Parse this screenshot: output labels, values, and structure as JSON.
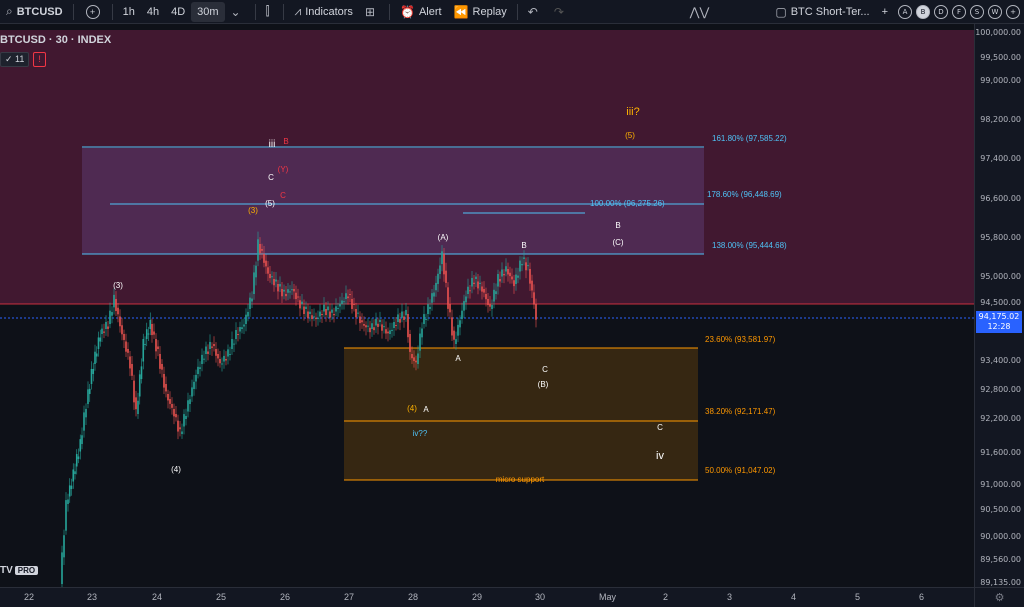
{
  "toolbar": {
    "symbol": "BTCUSD",
    "intervals": [
      "1h",
      "4h",
      "4D",
      "30m"
    ],
    "selected_interval": "30m",
    "indicators": "Indicators",
    "alert": "Alert",
    "replay": "Replay",
    "layout_name": "BTC Short-Ter...",
    "layout_buttons": [
      "A",
      "B",
      "D",
      "F",
      "S",
      "W"
    ],
    "selected_layout_button": "B",
    "more": "+"
  },
  "chart": {
    "title": "BTCUSD · 30 · INDEX",
    "badge_count": "✓ 11",
    "badge_alert": "!",
    "logo": "TV",
    "logo_pro": "PRO",
    "current_price": "94,175.02",
    "countdown": "12:28"
  },
  "price_axis": [
    "100,000.00",
    "99,500.00",
    "99,000.00",
    "98,200.00",
    "97,400.00",
    "96,600.00",
    "95,800.00",
    "95,000.00",
    "94,500.00",
    "93,400.00",
    "92,800.00",
    "92,200.00",
    "91,600.00",
    "91,000.00",
    "90,500.00",
    "90,000.00",
    "89,560.00",
    "89,135.00"
  ],
  "time_axis": [
    "22",
    "23",
    "24",
    "25",
    "26",
    "27",
    "28",
    "29",
    "30",
    "May",
    "2",
    "3",
    "4",
    "5",
    "6"
  ],
  "fib_levels": [
    {
      "label": "161.80% (97,585.22)",
      "color": "#4fc3f7"
    },
    {
      "label": "178.60% (96,448.69)",
      "color": "#4fc3f7"
    },
    {
      "label": "100.00% (96,275.26)",
      "color": "#4fc3f7"
    },
    {
      "label": "138.00% (95,444.68)",
      "color": "#4fc3f7"
    },
    {
      "label": "23.60% (93,581.97)",
      "color": "#ff9800"
    },
    {
      "label": "38.20% (92,171.47)",
      "color": "#ff9800"
    },
    {
      "label": "50.00% (91,047.02)",
      "color": "#ff9800"
    },
    {
      "label": "micro support",
      "color": "#ff9800"
    }
  ],
  "wave_labels": [
    "(3)",
    "(4)",
    "(5)",
    "(3)",
    "iii",
    "B",
    "C",
    "(Y)",
    "C",
    "(A)",
    "A",
    "B",
    "C",
    "(B)",
    "(4)",
    "A",
    "iv??",
    "iii?",
    "(5)",
    "B",
    "(C)",
    "C",
    "iv"
  ],
  "colors": {
    "bull": "#26a69a",
    "bear": "#ef5350",
    "zone_top": "#5a1f3c",
    "zone_bottom": "#3a2a14",
    "accent": "#2962ff"
  }
}
